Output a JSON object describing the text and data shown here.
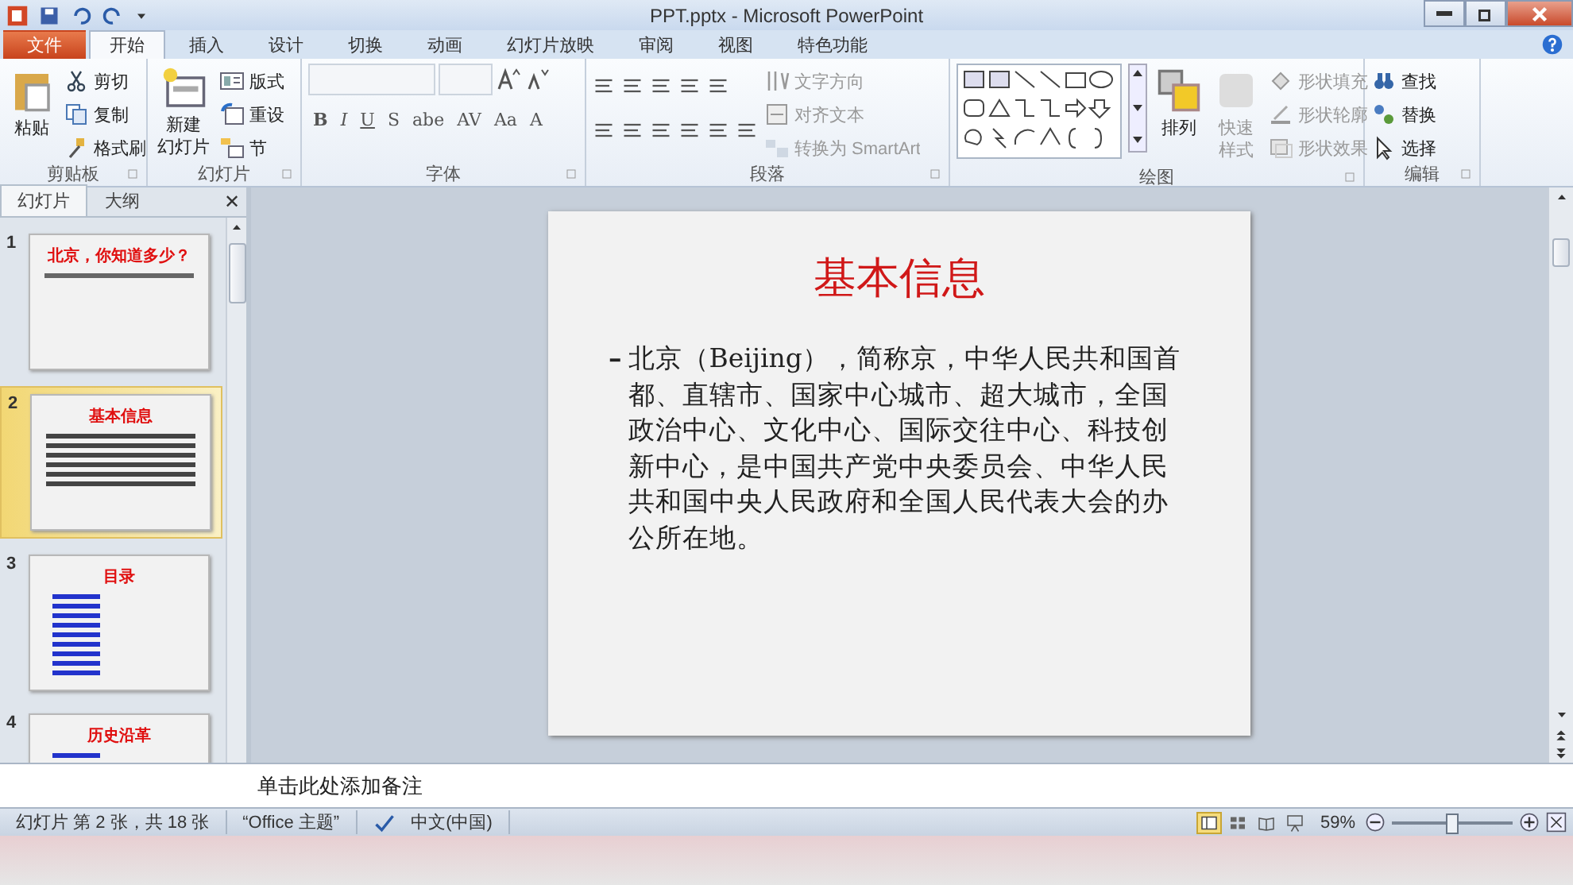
{
  "window": {
    "title": "PPT.pptx - Microsoft PowerPoint"
  },
  "tabs": [
    {
      "label": "文件",
      "kind": "file",
      "selected": false
    },
    {
      "label": "开始",
      "kind": "tab",
      "selected": true
    },
    {
      "label": "插入",
      "kind": "tab",
      "selected": false
    },
    {
      "label": "设计",
      "kind": "tab",
      "selected": false
    },
    {
      "label": "切换",
      "kind": "tab",
      "selected": false
    },
    {
      "label": "动画",
      "kind": "tab",
      "selected": false
    },
    {
      "label": "幻灯片放映",
      "kind": "tab",
      "selected": false
    },
    {
      "label": "审阅",
      "kind": "tab",
      "selected": false
    },
    {
      "label": "视图",
      "kind": "tab",
      "selected": false
    },
    {
      "label": "特色功能",
      "kind": "tab",
      "selected": false
    }
  ],
  "ribbon": {
    "clipboard": {
      "label": "剪贴板",
      "large": "粘贴",
      "small": [
        {
          "label": "剪切",
          "disabled": false
        },
        {
          "label": "复制",
          "disabled": false
        },
        {
          "label": "格式刷",
          "disabled": false
        }
      ]
    },
    "slides": {
      "label": "幻灯片",
      "large": [
        "新建",
        "幻灯片"
      ],
      "small": [
        {
          "label": "版式",
          "disabled": false
        },
        {
          "label": "重设",
          "disabled": false
        },
        {
          "label": "节",
          "disabled": false
        }
      ]
    },
    "font": {
      "label": "字体",
      "format_buttons": [
        "B",
        "I",
        "U",
        "S",
        "abe",
        "AV",
        "Aa",
        "A"
      ]
    },
    "paragraph": {
      "label": "段落",
      "small": [
        {
          "label": "文字方向",
          "disabled": true
        },
        {
          "label": "对齐文本",
          "disabled": true
        },
        {
          "label": "转换为 SmartArt",
          "disabled": true
        }
      ]
    },
    "drawing": {
      "label": "绘图",
      "large": [
        {
          "label": "排列",
          "disabled": false
        },
        {
          "label": "快速样式",
          "disabled": true
        }
      ],
      "small": [
        {
          "label": "形状填充",
          "disabled": true
        },
        {
          "label": "形状轮廓",
          "disabled": true
        },
        {
          "label": "形状效果",
          "disabled": true
        }
      ]
    },
    "editing": {
      "label": "编辑",
      "small": [
        {
          "label": "查找",
          "disabled": false
        },
        {
          "label": "替换",
          "disabled": false
        },
        {
          "label": "选择",
          "disabled": false
        }
      ]
    }
  },
  "sidebar": {
    "tabs": [
      {
        "label": "幻灯片",
        "selected": true
      },
      {
        "label": "大纲",
        "selected": false
      }
    ],
    "close": "✕",
    "slides": [
      {
        "number": "1",
        "title": "北京，你知道多少？",
        "selected": false
      },
      {
        "number": "2",
        "title": "基本信息",
        "selected": true
      },
      {
        "number": "3",
        "title": "目录",
        "selected": false
      },
      {
        "number": "4",
        "title": "历史沿革",
        "selected": false
      }
    ]
  },
  "slide": {
    "title": "基本信息",
    "bullet": "–",
    "body": "北京（Beijing），简称京，中华人民共和国首都、直辖市、国家中心城市、超大城市，全国政治中心、文化中心、国际交往中心、科技创新中心，是中国共产党中央委员会、中华人民共和国中央人民政府和全国人民代表大会的办公所在地。"
  },
  "notes": {
    "placeholder": "单击此处添加备注"
  },
  "status_bar": {
    "slide_info": "幻灯片 第 2 张，共 18 张",
    "theme": "“Office 主题”",
    "language": "中文(中国)",
    "views": [
      {
        "selected": true
      },
      {
        "selected": false
      },
      {
        "selected": false
      },
      {
        "selected": false
      }
    ],
    "zoom": "59%",
    "zoom_slider": {
      "level": 0.5
    }
  }
}
